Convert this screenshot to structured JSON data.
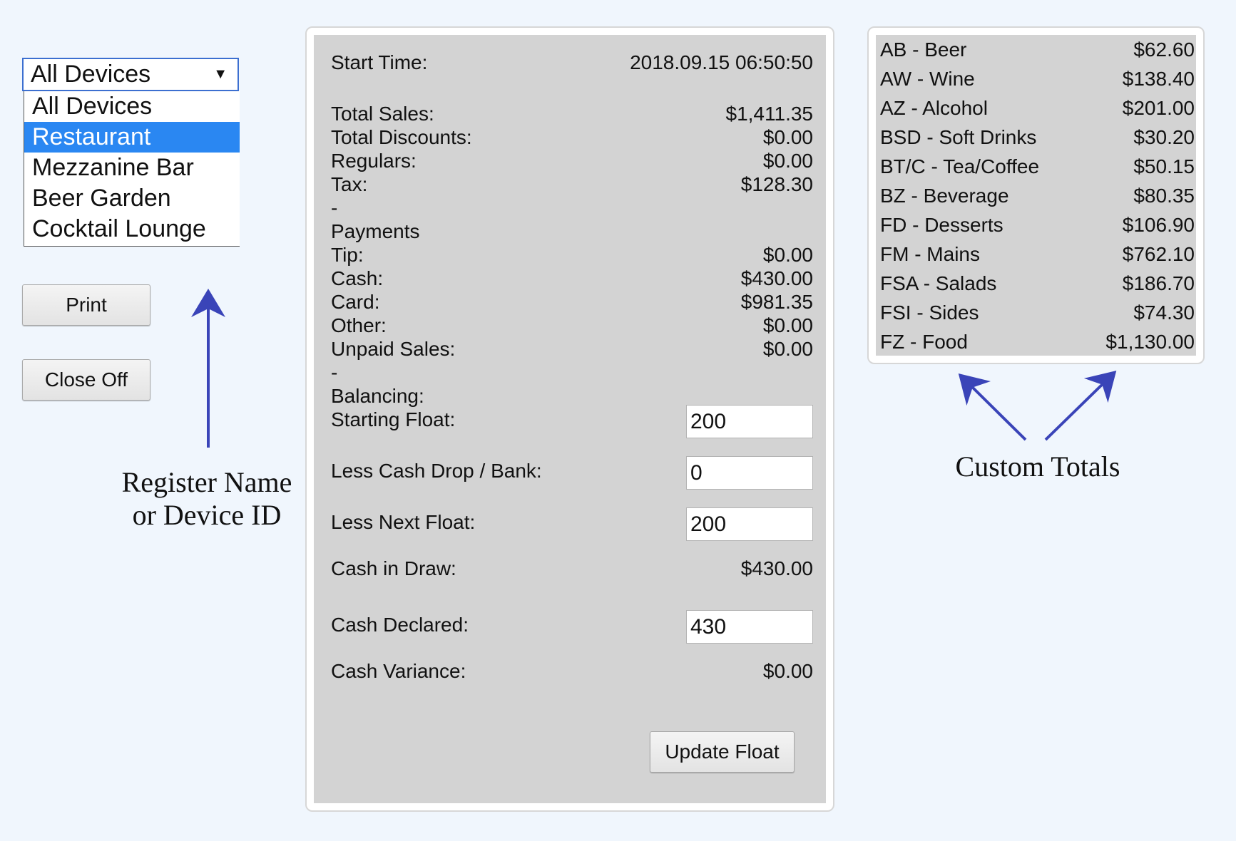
{
  "device_selector": {
    "selected": "All Devices",
    "caret": "▼",
    "options": [
      "All Devices",
      "Restaurant",
      "Mezzanine Bar",
      "Beer Garden",
      "Cocktail Lounge"
    ],
    "highlighted": "Restaurant"
  },
  "buttons": {
    "print": "Print",
    "close_off": "Close Off",
    "update_float": "Update Float"
  },
  "annotations": {
    "register_line1": "Register Name",
    "register_line2": "or Device ID",
    "custom_totals": "Custom Totals"
  },
  "session": {
    "start_time_label": "Start Time:",
    "start_time_value": "2018.09.15 06:50:50",
    "total_sales_label": "Total Sales:",
    "total_sales_value": "$1,411.35",
    "total_discounts_label": "Total Discounts:",
    "total_discounts_value": "$0.00",
    "regulars_label": "Regulars:",
    "regulars_value": "$0.00",
    "tax_label": "Tax:",
    "tax_value": "$128.30",
    "separator": "-",
    "payments_label": "Payments",
    "tip_label": "Tip:",
    "tip_value": "$0.00",
    "cash_label": "Cash:",
    "cash_value": "$430.00",
    "card_label": "Card:",
    "card_value": "$981.35",
    "other_label": "Other:",
    "other_value": "$0.00",
    "unpaid_label": "Unpaid Sales:",
    "unpaid_value": "$0.00",
    "balancing_label": "Balancing:",
    "starting_float_label": "Starting Float:",
    "starting_float_value": "200",
    "cash_drop_label": "Less Cash Drop / Bank:",
    "cash_drop_value": "0",
    "next_float_label": "Less Next Float:",
    "next_float_value": "200",
    "cash_in_draw_label": "Cash in Draw:",
    "cash_in_draw_value": "$430.00",
    "cash_declared_label": "Cash Declared:",
    "cash_declared_value": "430",
    "cash_variance_label": "Cash Variance:",
    "cash_variance_value": "$0.00"
  },
  "custom_totals": [
    {
      "label": "AB - Beer",
      "value": "$62.60"
    },
    {
      "label": "AW - Wine",
      "value": "$138.40"
    },
    {
      "label": "AZ - Alcohol",
      "value": "$201.00"
    },
    {
      "label": "BSD - Soft Drinks",
      "value": "$30.20"
    },
    {
      "label": "BT/C - Tea/Coffee",
      "value": "$50.15"
    },
    {
      "label": "BZ - Beverage",
      "value": "$80.35"
    },
    {
      "label": "FD - Desserts",
      "value": "$106.90"
    },
    {
      "label": "FM - Mains",
      "value": "$762.10"
    },
    {
      "label": "FSA - Salads",
      "value": "$186.70"
    },
    {
      "label": "FSI - Sides",
      "value": "$74.30"
    },
    {
      "label": "FZ - Food",
      "value": "$1,130.00"
    }
  ],
  "colors": {
    "background": "#f0f6fd",
    "panel": "#d3d3d3",
    "highlight": "#2a87f2",
    "arrow": "#3a44b8"
  }
}
